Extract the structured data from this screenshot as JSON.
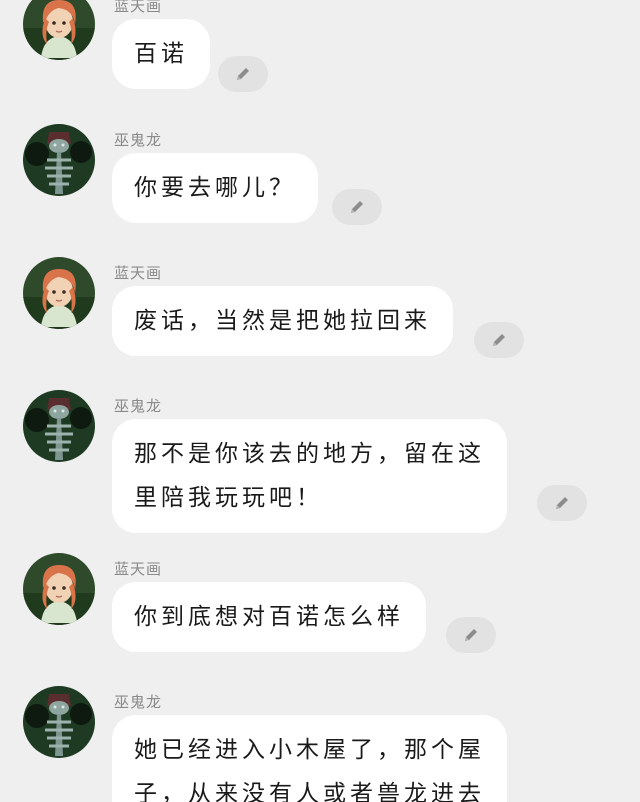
{
  "messages": [
    {
      "sender": "蓝天画",
      "avatar": "girl-avatar",
      "lines": [
        "百诺"
      ]
    },
    {
      "sender": "巫鬼龙",
      "avatar": "dragon-avatar",
      "lines": [
        "你要去哪儿？"
      ]
    },
    {
      "sender": "蓝天画",
      "avatar": "girl-avatar",
      "lines": [
        "废话，当然是把她拉回来"
      ]
    },
    {
      "sender": "巫鬼龙",
      "avatar": "dragon-avatar",
      "lines": [
        "那不是你该去的地方，留在这",
        "里陪我玩玩吧！"
      ]
    },
    {
      "sender": "蓝天画",
      "avatar": "girl-avatar",
      "lines": [
        "你到底想对百诺怎么样"
      ]
    },
    {
      "sender": "巫鬼龙",
      "avatar": "dragon-avatar",
      "lines": [
        "她已经进入小木屋了，那个屋",
        "子，从来没有人或者兽龙进去"
      ]
    }
  ],
  "icons": {
    "edit": "pencil-icon"
  },
  "colors": {
    "background": "#efefef",
    "bubble": "#ffffff",
    "edit_button": "#e2e2e2",
    "edit_icon": "#8c8c8c"
  }
}
